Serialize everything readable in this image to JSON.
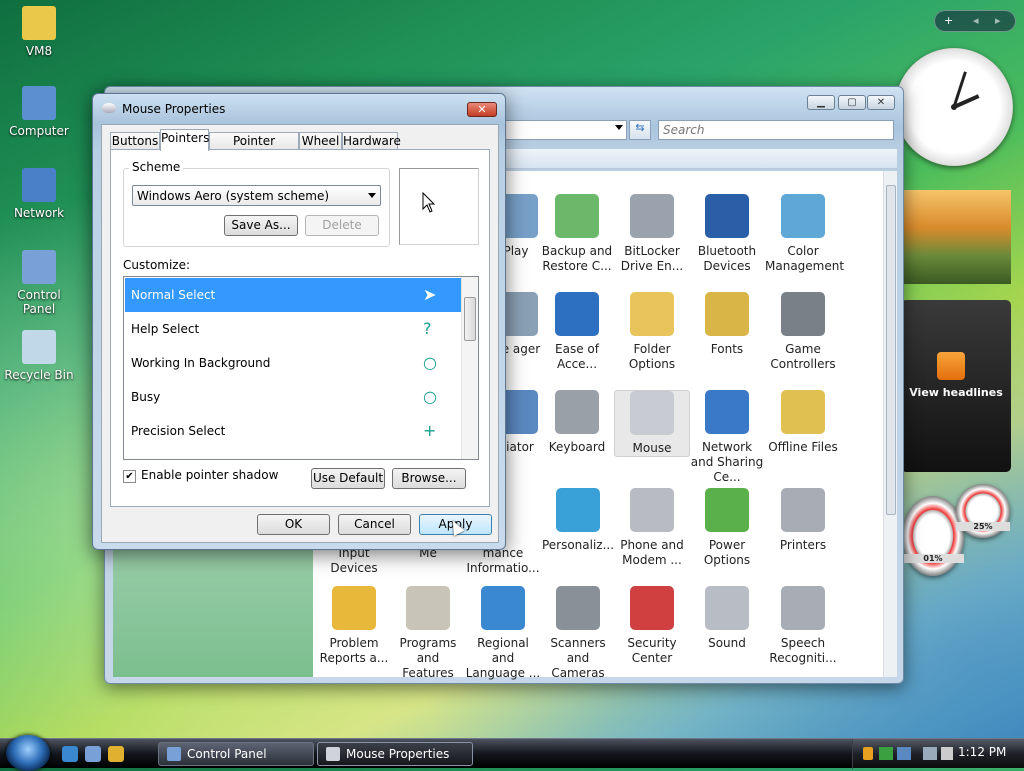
{
  "desktop": {
    "icons": [
      {
        "label": "VM8",
        "color": "#e9c84a"
      },
      {
        "label": "Computer",
        "color": "#5a8fd0"
      },
      {
        "label": "Network",
        "color": "#4a80c8"
      },
      {
        "label": "Control Panel",
        "color": "#7aa0d8"
      },
      {
        "label": "Recycle Bin",
        "color": "#c0d8e8"
      }
    ]
  },
  "control_panel": {
    "search_placeholder": "Search",
    "items": [
      {
        "label": "Play",
        "color": "#77a0c8"
      },
      {
        "label": "Backup and Restore C...",
        "color": "#6cb86a"
      },
      {
        "label": "BitLocker Drive En...",
        "color": "#9aa3ad"
      },
      {
        "label": "Bluetooth Devices",
        "color": "#2a5fa8"
      },
      {
        "label": "Color Management",
        "color": "#5ea8d8"
      },
      {
        "label": "ice ager",
        "color": "#8aa0b4"
      },
      {
        "label": "Ease of Acce...",
        "color": "#2d6fc0"
      },
      {
        "label": "Folder Options",
        "color": "#e8c45a"
      },
      {
        "label": "Fonts",
        "color": "#d9b548"
      },
      {
        "label": "Game Controllers",
        "color": "#7a8088"
      },
      {
        "label": "itiator",
        "color": "#5a88c0"
      },
      {
        "label": "Keyboard",
        "color": "#9aa0a8"
      },
      {
        "label": "Mouse",
        "color": "#c8ccd2"
      },
      {
        "label": "Network and Sharing Ce...",
        "color": "#3a78c8"
      },
      {
        "label": "Offline Files",
        "color": "#e0c050"
      },
      {
        "label": "Input Devices",
        "color": "#ffffff"
      },
      {
        "label": "Me",
        "color": "#ffffff"
      },
      {
        "label": "mance Informatio...",
        "color": "#6a9a7a"
      },
      {
        "label": "Personaliz...",
        "color": "#3aa0d8"
      },
      {
        "label": "Phone and Modem ...",
        "color": "#b8bcc2"
      },
      {
        "label": "Power Options",
        "color": "#5ab04a"
      },
      {
        "label": "Printers",
        "color": "#a8acb4"
      },
      {
        "label": "Problem Reports a...",
        "color": "#e8b83a"
      },
      {
        "label": "Programs and Features",
        "color": "#c8c4b8"
      },
      {
        "label": "Regional and Language ...",
        "color": "#3a88d0"
      },
      {
        "label": "Scanners and Cameras",
        "color": "#8a9098"
      },
      {
        "label": "Security Center",
        "color": "#d04040"
      },
      {
        "label": "Sound",
        "color": "#b8bcc4"
      },
      {
        "label": "Speech Recogniti...",
        "color": "#a8acb4"
      }
    ]
  },
  "dialog": {
    "title": "Mouse Properties",
    "tabs": [
      "Buttons",
      "Pointers",
      "Pointer Options",
      "Wheel",
      "Hardware"
    ],
    "active_tab": "Pointers",
    "scheme_label": "Scheme",
    "scheme_value": "Windows Aero (system scheme)",
    "save_as": "Save As...",
    "delete": "Delete",
    "customize_label": "Customize:",
    "pointers": [
      {
        "name": "Normal Select",
        "selected": true,
        "glyph": ""
      },
      {
        "name": "Help Select",
        "selected": false,
        "glyph": "?"
      },
      {
        "name": "Working In Background",
        "selected": false,
        "glyph": "○"
      },
      {
        "name": "Busy",
        "selected": false,
        "glyph": "○"
      },
      {
        "name": "Precision Select",
        "selected": false,
        "glyph": "+"
      }
    ],
    "shadow_label": "Enable pointer shadow",
    "shadow_checked": true,
    "use_default": "Use Default",
    "browse": "Browse...",
    "ok": "OK",
    "cancel": "Cancel",
    "apply": "Apply"
  },
  "sidebar": {
    "feed_label": "View headlines",
    "cpu": "01%",
    "mem": "25%"
  },
  "taskbar": {
    "tasks": [
      {
        "label": "Control Panel",
        "active": false
      },
      {
        "label": "Mouse Properties",
        "active": true
      }
    ],
    "time": "1:12 PM"
  }
}
